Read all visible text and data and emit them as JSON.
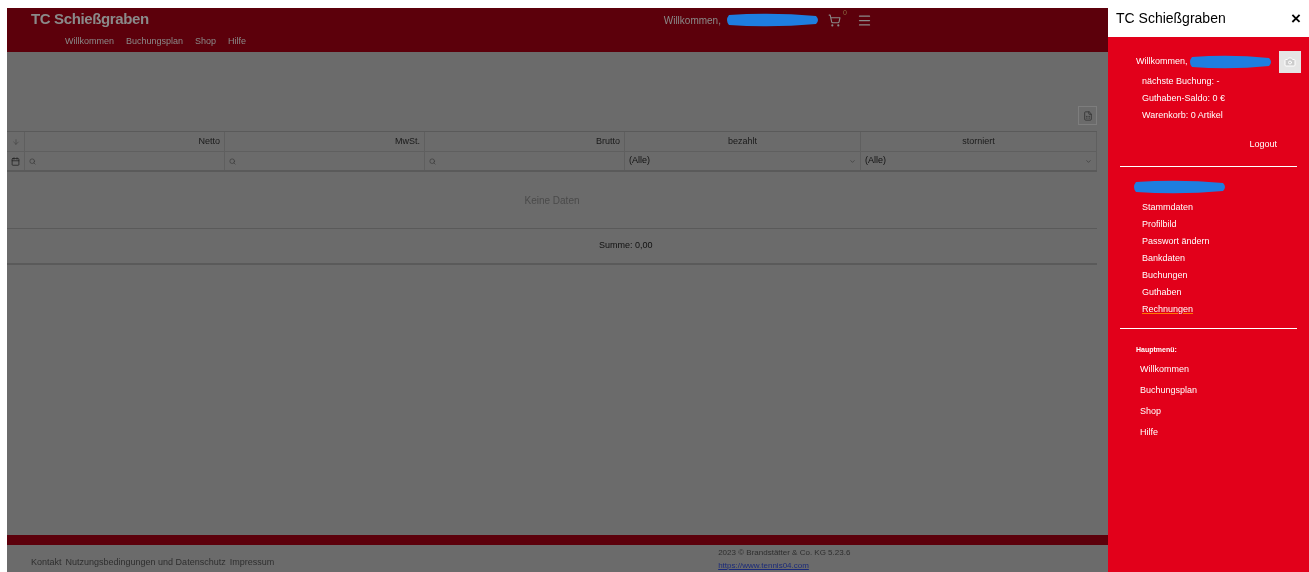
{
  "header": {
    "title": "TC Schießgraben",
    "nav": [
      "Willkommen",
      "Buchungsplan",
      "Shop",
      "Hilfe"
    ],
    "welcome": "Willkommen,",
    "cart_count": "0"
  },
  "table": {
    "columns": [
      {
        "label": "Netto",
        "kind": "search"
      },
      {
        "label": "MwSt.",
        "kind": "search"
      },
      {
        "label": "Brutto",
        "kind": "search"
      },
      {
        "label": "bezahlt",
        "kind": "select",
        "value": "(Alle)"
      },
      {
        "label": "storniert",
        "kind": "select",
        "value": "(Alle)"
      }
    ],
    "empty_text": "Keine Daten",
    "summary": "Summe: 0,00"
  },
  "footer": {
    "links": [
      "Kontakt",
      "Nutzungsbedingungen und Datenschutz",
      "Impressum"
    ],
    "copyright": "2023 © Brandstätter & Co. KG  5.23.6",
    "url": "https://www.tennis04.com"
  },
  "side_panel": {
    "title": "TC Schießgraben",
    "close": "×",
    "welcome": "Willkommen,",
    "info": [
      "nächste Buchung: -",
      "Guthaben-Saldo: 0 €",
      "Warenkorb: 0 Artikel"
    ],
    "logout": "Logout",
    "account_items": [
      {
        "label": "Stammdaten",
        "hovered": false
      },
      {
        "label": "Profilbild",
        "hovered": false
      },
      {
        "label": "Passwort ändern",
        "hovered": false
      },
      {
        "label": "Bankdaten",
        "hovered": false
      },
      {
        "label": "Buchungen",
        "hovered": false
      },
      {
        "label": "Guthaben",
        "hovered": false
      },
      {
        "label": "Rechnungen",
        "hovered": true
      }
    ],
    "main_menu_title": "Hauptmenü:",
    "main_menu": [
      "Willkommen",
      "Buchungsplan",
      "Shop",
      "Hilfe"
    ]
  }
}
